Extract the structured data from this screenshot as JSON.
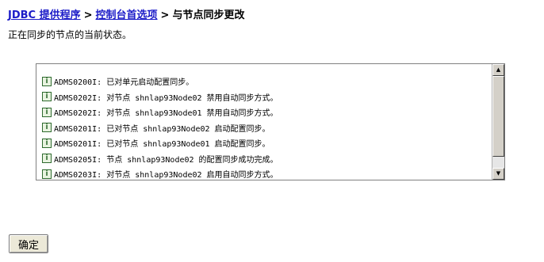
{
  "breadcrumb": {
    "items": [
      "JDBC 提供程序",
      "控制台首选项"
    ],
    "separator": ">",
    "current": "与节点同步更改"
  },
  "description": "正在同步的节点的当前状态。",
  "log": {
    "entries": [
      "ADMS0200I: 已对单元启动配置同步。",
      "ADMS0202I: 对节点 shnlap93Node02 禁用自动同步方式。",
      "ADMS0202I: 对节点 shnlap93Node01 禁用自动同步方式。",
      "ADMS0201I: 已对节点 shnlap93Node02 启动配置同步。",
      "ADMS0201I: 已对节点 shnlap93Node01 启动配置同步。",
      "ADMS0205I: 节点 shnlap93Node02 的配置同步成功完成。",
      "ADMS0203I: 对节点 shnlap93Node02 启用自动同步方式。"
    ],
    "icon": "info-icon"
  },
  "actions": {
    "ok_label": "确定"
  },
  "colors": {
    "link": "#1c1cc8",
    "border": "#808080",
    "scrollbar": "#d4d0c8"
  }
}
